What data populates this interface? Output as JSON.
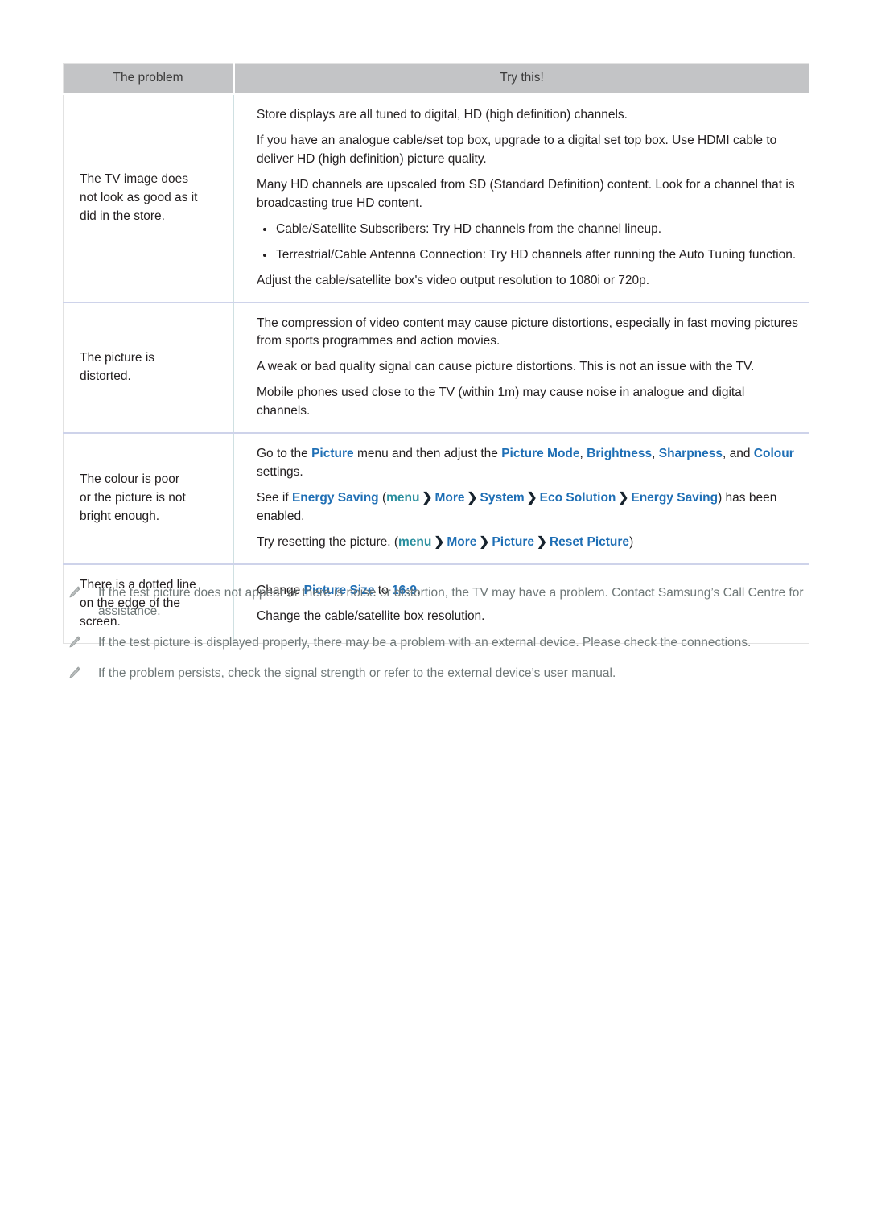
{
  "table": {
    "columns": [
      "The problem",
      "Try this!"
    ],
    "rows": [
      {
        "problem": [
          "The TV image does",
          "not look as good as it",
          "did in the store."
        ],
        "paragraphs": [
          "Store displays are all tuned to digital, HD (high definition) channels.",
          "If you have an analogue cable/set top box, upgrade to a digital set top box. Use HDMI cable to deliver HD (high definition) picture quality.",
          "Many HD channels are upscaled from SD (Standard Definition) content. Look for a channel that is broadcasting true HD content."
        ],
        "bullets": [
          "Cable/Satellite Subscribers: Try HD channels from the channel lineup.",
          "Terrestrial/Cable Antenna Connection: Try HD channels after running the Auto Tuning function."
        ],
        "tail": "Adjust the cable/satellite box's video output resolution to 1080i or 720p."
      },
      {
        "problem": [
          "The picture is",
          "distorted."
        ],
        "paragraphs": [
          "The compression of video content may cause picture distortions, especially in fast moving pictures from sports programmes and action movies.",
          "A weak or bad quality signal can cause picture distortions. This is not an issue with the TV.",
          "Mobile phones used close to the TV (within 1m) may cause noise in analogue and digital channels."
        ]
      },
      {
        "problem": [
          "The colour is poor",
          "or the picture is not",
          "bright enough."
        ],
        "rich": {
          "line1": {
            "t1": "Go to the ",
            "m1": "Picture",
            "t2": " menu and then adjust the ",
            "m2": "Picture Mode",
            "t3": ", ",
            "m3": "Brightness",
            "t4": ", ",
            "m4": "Sharpness",
            "t5": ", and ",
            "m5": "Colour",
            "t6": " settings."
          },
          "line2": {
            "t1": "See if ",
            "m1": "Energy Saving",
            "t2": " (",
            "menu": "menu",
            "c1": "❯",
            "m2": "More",
            "c2": "❯",
            "m3": "System",
            "c3": "❯",
            "m4": "Eco Solution",
            "c4": "❯",
            "m5": "Energy Saving",
            "t3": ") has been enabled."
          },
          "line3": {
            "t1": "Try resetting the picture. (",
            "menu": "menu",
            "c1": "❯",
            "m2": "More",
            "c2": "❯",
            "m3": "Picture",
            "c3": "❯",
            "m4": "Reset Picture",
            "t2": ")"
          }
        }
      },
      {
        "problem": [
          "There is a dotted line",
          "on the edge of the",
          "screen."
        ],
        "rich2": {
          "line1": {
            "t1": "Change ",
            "m1": "Picture Size",
            "t2": " to ",
            "m2": "16:9",
            "t3": "."
          },
          "line2": "Change the cable/satellite box resolution."
        }
      }
    ]
  },
  "notes": [
    "If the test picture does not appear or there is noise or distortion, the TV may have a problem. Contact Samsung’s Call Centre for assistance.",
    "If the test picture is displayed properly, there may be a problem with an external device. Please check the connections.",
    "If the problem persists, check the signal strength or refer to the external device’s user manual."
  ],
  "icons": {
    "note_marker": "pencil-icon"
  },
  "colors": {
    "header_bg": "#c3c4c6",
    "menu_blue": "#1f6fb5",
    "menu_teal": "#2a8f9e",
    "note_text": "#6f7878",
    "row_divider": "#ced3ea",
    "body_text": "#231f20"
  }
}
